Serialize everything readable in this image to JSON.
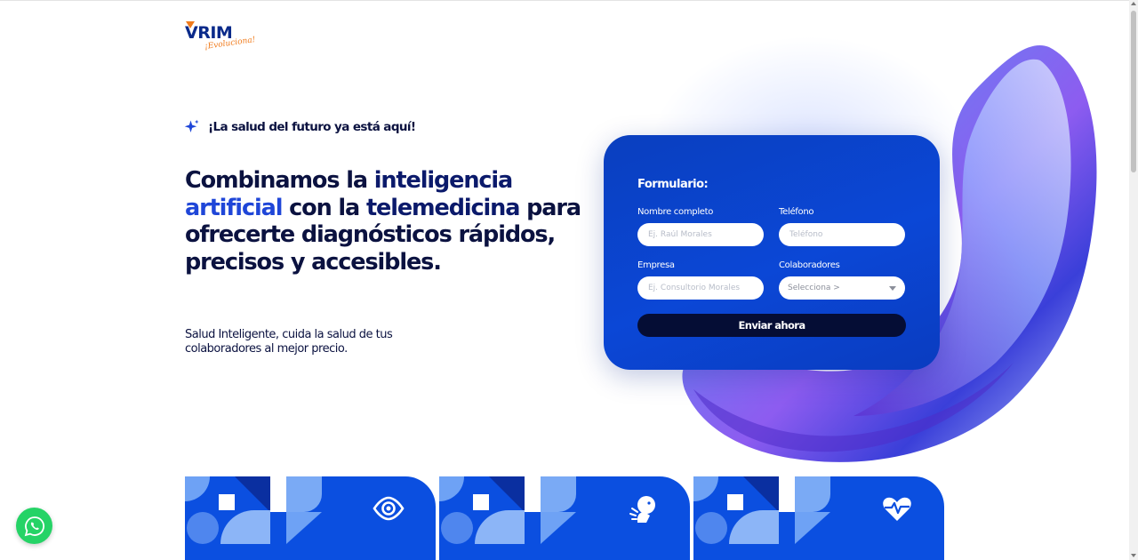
{
  "brand": {
    "name": "VRIM",
    "tagline": "¡Evoluciona!",
    "colors": {
      "primary": "#0b47d6",
      "accent": "#f07b1c",
      "dark": "#050d35"
    }
  },
  "hero": {
    "kicker": "¡La salud del futuro ya está aquí!",
    "headline": {
      "p1": "Combinamos la ",
      "b1": "inteligencia",
      "p2": " ",
      "b2": "artificial",
      "p3": " con la ",
      "b3": "telemedicina",
      "p4": " para ofrecerte diagnósticos rápidos, precisos y accesibles."
    },
    "subtext": "Salud Inteligente, cuida la salud de tus colaboradores al mejor precio."
  },
  "form": {
    "title": "Formulario:",
    "name_label": "Nombre completo",
    "name_placeholder": "Ej. Raúl Morales",
    "phone_label": "Teléfono",
    "phone_placeholder": "Teléfono",
    "company_label": "Empresa",
    "company_placeholder": "Ej. Consultorio Morales",
    "collaborators_label": "Colaboradores",
    "collaborators_value": "Selecciona >",
    "submit_label": "Enviar ahora"
  },
  "features": [
    {
      "icon": "eye-icon"
    },
    {
      "icon": "cough-icon"
    },
    {
      "icon": "heart-pulse-icon"
    }
  ],
  "whatsapp": {
    "icon": "whatsapp-icon",
    "color": "#25d366"
  }
}
